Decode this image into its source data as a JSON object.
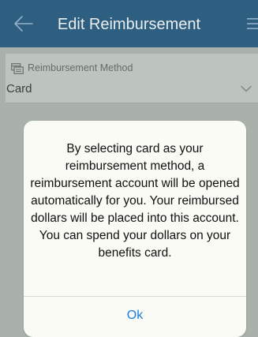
{
  "header": {
    "title": "Edit Reimbursement",
    "back_icon": "arrow-left-icon",
    "menu_icon": "hamburger-menu-icon"
  },
  "form": {
    "reimbursement_method": {
      "label": "Reimbursement Method",
      "icon": "payment-terminal-icon",
      "value": "Card",
      "dropdown_icon": "chevron-down-icon"
    }
  },
  "dialog": {
    "message": "By selecting card as your reimbursement method, a reimbursement account will be opened automatically for you. Your reimbursed dollars will be placed into this account. You can spend your dollars on your benefits card.",
    "ok_label": "Ok"
  },
  "colors": {
    "header_bg": "#2f5f80",
    "accent": "#1e7be0"
  }
}
